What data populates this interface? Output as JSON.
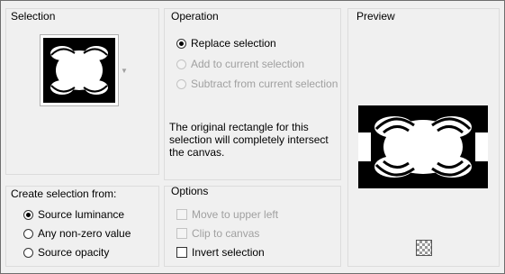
{
  "selection": {
    "title": "Selection"
  },
  "operation": {
    "title": "Operation",
    "options": [
      {
        "label": "Replace selection",
        "checked": true,
        "enabled": true
      },
      {
        "label": "Add to current selection",
        "checked": false,
        "enabled": false
      },
      {
        "label": "Subtract from current selection",
        "checked": false,
        "enabled": false
      }
    ],
    "message_lines": [
      "The original rectangle for this",
      "selection will completely intersect",
      "the canvas."
    ]
  },
  "preview": {
    "title": "Preview"
  },
  "create_from": {
    "title": "Create selection from:",
    "options": [
      {
        "label": "Source luminance",
        "checked": true
      },
      {
        "label": "Any non-zero value",
        "checked": false
      },
      {
        "label": "Source opacity",
        "checked": false
      }
    ]
  },
  "options": {
    "title": "Options",
    "items": [
      {
        "label": "Move to upper left",
        "checked": false,
        "enabled": false
      },
      {
        "label": "Clip to canvas",
        "checked": false,
        "enabled": false
      },
      {
        "label": "Invert selection",
        "checked": false,
        "enabled": true
      }
    ]
  },
  "colors": {
    "border": "#6e6e6e",
    "background": "#f0f0f0",
    "disabled_text": "#a0a0a0"
  }
}
